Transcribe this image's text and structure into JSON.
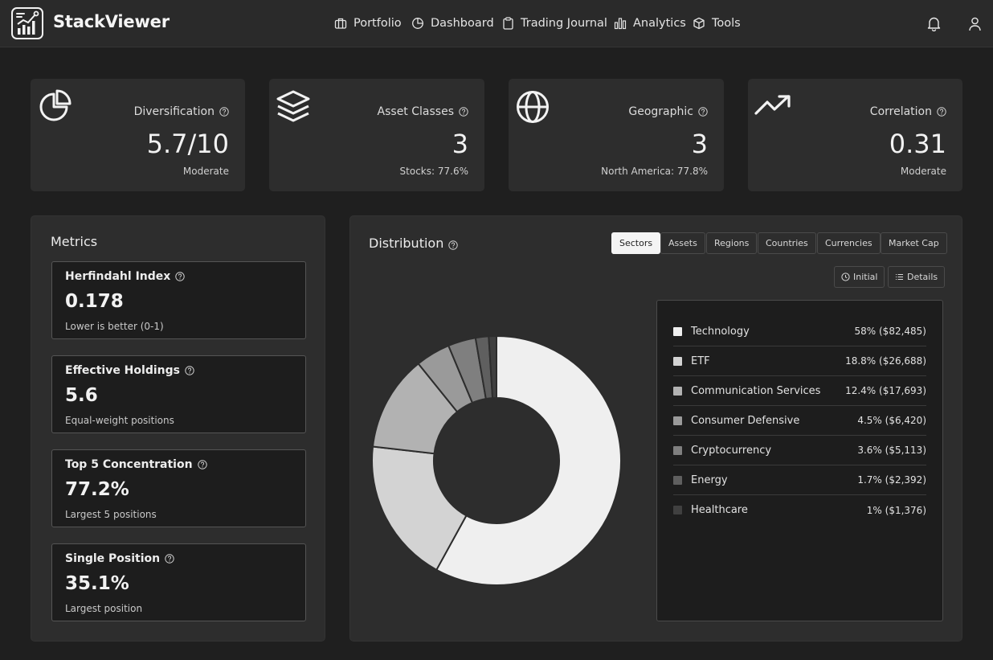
{
  "app": {
    "brand": "StackViewer"
  },
  "nav": [
    {
      "label": "Portfolio",
      "icon": "briefcase-icon"
    },
    {
      "label": "Dashboard",
      "icon": "pie-chart-icon"
    },
    {
      "label": "Trading Journal",
      "icon": "clipboard-icon"
    },
    {
      "label": "Analytics",
      "icon": "bar-chart-icon"
    },
    {
      "label": "Tools",
      "icon": "cube-icon"
    }
  ],
  "stats": [
    {
      "label": "Diversification",
      "value": "5.7/10",
      "sub": "Moderate",
      "icon": "pie-chart-icon"
    },
    {
      "label": "Asset Classes",
      "value": "3",
      "sub": "Stocks: 77.6%",
      "icon": "layers-icon"
    },
    {
      "label": "Geographic",
      "value": "3",
      "sub": "North America: 77.8%",
      "icon": "globe-icon"
    },
    {
      "label": "Correlation",
      "value": "0.31",
      "sub": "Moderate",
      "icon": "trending-up-icon"
    }
  ],
  "metrics": {
    "title": "Metrics",
    "items": [
      {
        "label": "Herfindahl Index",
        "value": "0.178",
        "sub": "Lower is better (0-1)"
      },
      {
        "label": "Effective Holdings",
        "value": "5.6",
        "sub": "Equal-weight positions"
      },
      {
        "label": "Top 5 Concentration",
        "value": "77.2%",
        "sub": "Largest 5 positions"
      },
      {
        "label": "Single Position",
        "value": "35.1%",
        "sub": "Largest position"
      }
    ]
  },
  "distribution": {
    "title": "Distribution",
    "tabs": [
      "Sectors",
      "Assets",
      "Regions",
      "Countries",
      "Currencies",
      "Market Cap"
    ],
    "active_tab": "Sectors",
    "buttons": {
      "initial": "Initial",
      "details": "Details"
    }
  },
  "chart_data": {
    "type": "pie",
    "variant": "donut",
    "categories": [
      "Technology",
      "ETF",
      "Communication Services",
      "Consumer Defensive",
      "Cryptocurrency",
      "Energy",
      "Healthcare"
    ],
    "values": [
      58,
      18.8,
      12.4,
      4.5,
      3.6,
      1.7,
      1
    ],
    "amounts": [
      "$82,485",
      "$26,688",
      "$17,693",
      "$6,420",
      "$5,113",
      "$2,392",
      "$1,376"
    ],
    "labels": [
      "58% ($82,485)",
      "18.8% ($26,688)",
      "12.4% ($17,693)",
      "4.5% ($6,420)",
      "3.6% ($5,113)",
      "1.7% ($2,392)",
      "1% ($1,376)"
    ],
    "colors": [
      "#efefef",
      "#d3d3d3",
      "#b2b2b2",
      "#9a9a9a",
      "#7f7f7f",
      "#5f5f5f",
      "#404040"
    ],
    "legend_position": "right"
  }
}
